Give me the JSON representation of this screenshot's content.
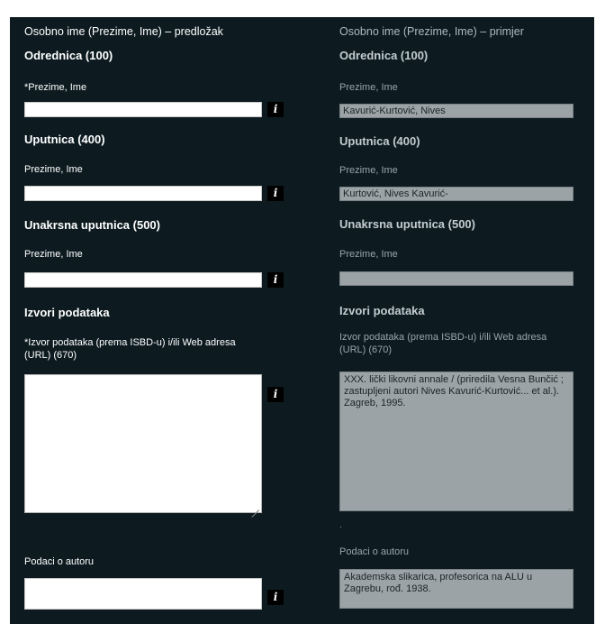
{
  "template": {
    "title": "Osobno ime (Prezime, Ime) – predložak",
    "section_main": "Odrednica (100)",
    "main_label": "*Prezime, Ime",
    "section_ref": "Uputnica (400)",
    "ref_label": "Prezime, Ime",
    "section_cross": "Unakrsna uputnica (500)",
    "cross_label": "Prezime, Ime",
    "section_sources": "Izvori podataka",
    "sources_label": "*Izvor podataka (prema ISBD-u) i/ili Web adresa (URL) (670)",
    "author_label": "Podaci o autoru",
    "info_glyph": "i",
    "main_value": "",
    "ref_value": "",
    "cross_value": "",
    "sources_value": "",
    "author_value": ""
  },
  "example": {
    "title": "Osobno ime (Prezime, Ime) – primjer",
    "section_main": "Odrednica (100)",
    "main_label": "Prezime, Ime",
    "main_value": "Kavurić-Kurtović, Nives",
    "section_ref": "Uputnica (400)",
    "ref_label": "Prezime, Ime",
    "ref_value": "Kurtović, Nives Kavurić-",
    "section_cross": "Unakrsna uputnica (500)",
    "cross_label": "Prezime, Ime",
    "cross_value": "",
    "section_sources": "Izvori podataka",
    "sources_label": "Izvor podataka (prema ISBD-u) i/ili Web adresa (URL) (670)",
    "sources_value": "XXX. lički likovni annale / (priredila Vesna Bunčić ; zastupljeni autori Nives Kavurić-Kurtović... et al.). Zagreb, 1995.",
    "dot": ".",
    "author_label": "Podaci o autoru",
    "author_value": "Akademska slikarica, profesorica na ALU u Zagrebu, rođ. 1938."
  },
  "colors": {
    "background": "#0d1b21",
    "example_field": "#9ba3a7",
    "info_button": "#000000"
  },
  "icons": [
    "info-icon",
    "resize-grip-icon"
  ]
}
